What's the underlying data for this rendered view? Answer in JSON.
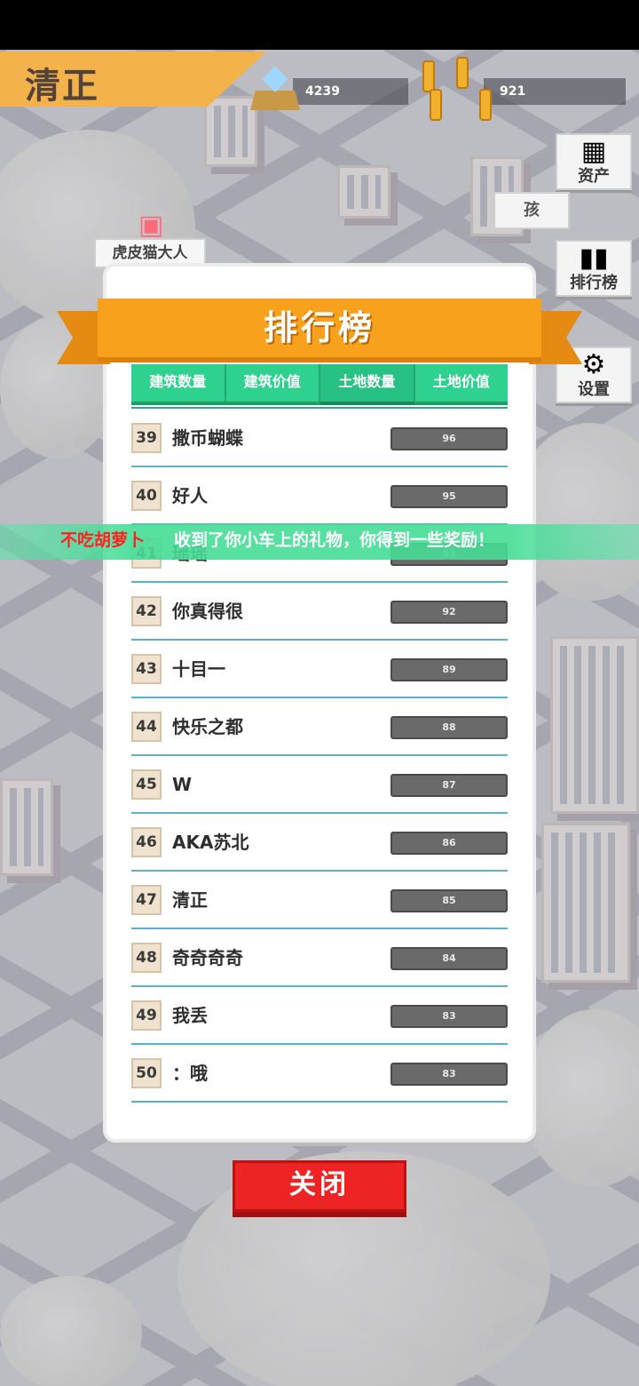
{
  "hud": {
    "player_name": "清正",
    "diamonds": "4239",
    "coins": "921",
    "assets_label": "资产",
    "leaderboard_label": "排行榜",
    "settings_label": "设置",
    "hint_text": "孩",
    "gift_player": "虎皮猫大人"
  },
  "panel": {
    "title": "排行榜",
    "tabs": [
      {
        "label": "建筑数量"
      },
      {
        "label": "建筑价值"
      },
      {
        "label": "土地数量"
      },
      {
        "label": "土地价值"
      }
    ],
    "rows": [
      {
        "rank": "39",
        "name": "撒币蝴蝶",
        "score": "96"
      },
      {
        "rank": "40",
        "name": "好人",
        "score": "95"
      },
      {
        "rank": "41",
        "name": "瑶瑶",
        "score": "93"
      },
      {
        "rank": "42",
        "name": "你真得很",
        "score": "92"
      },
      {
        "rank": "43",
        "name": "十目一",
        "score": "89"
      },
      {
        "rank": "44",
        "name": "快乐之都",
        "score": "88"
      },
      {
        "rank": "45",
        "name": "W",
        "score": "87"
      },
      {
        "rank": "46",
        "name": "AKA苏北",
        "score": "86"
      },
      {
        "rank": "47",
        "name": "清正",
        "score": "85"
      },
      {
        "rank": "48",
        "name": "奇奇奇奇",
        "score": "84"
      },
      {
        "rank": "49",
        "name": "我丢",
        "score": "83"
      },
      {
        "rank": "50",
        "name": "：哦",
        "score": "83"
      }
    ],
    "close_label": "关闭"
  },
  "toast": {
    "sender": "不吃胡萝卜",
    "message": "收到了你小车上的礼物，你得到一些奖励！"
  }
}
